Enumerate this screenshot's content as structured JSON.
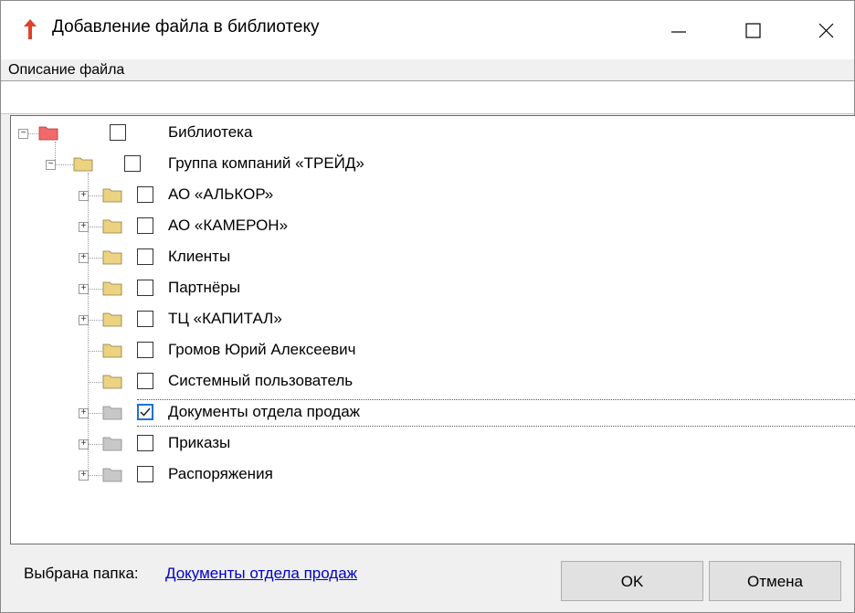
{
  "window": {
    "title": "Добавление файла в библиотеку",
    "app_icon": "red-arrow-up-icon"
  },
  "description": {
    "label": "Описание файла",
    "value": ""
  },
  "tree": {
    "nodes": [
      {
        "label": "Библиотека",
        "level": 0,
        "expanded": true,
        "has_children": true,
        "folder_color": "#f06a6a",
        "checked": false,
        "selected": false
      },
      {
        "label": "Группа компаний «ТРЕЙД»",
        "level": 1,
        "expanded": true,
        "has_children": true,
        "folder_color": "#ecd382",
        "checked": false,
        "selected": false
      },
      {
        "label": "АО «АЛЬКОР»",
        "level": 2,
        "expanded": false,
        "has_children": true,
        "folder_color": "#ecd382",
        "checked": false,
        "selected": false
      },
      {
        "label": "АО «КАМЕРОН»",
        "level": 2,
        "expanded": false,
        "has_children": true,
        "folder_color": "#ecd382",
        "checked": false,
        "selected": false
      },
      {
        "label": "Клиенты",
        "level": 2,
        "expanded": false,
        "has_children": true,
        "folder_color": "#ecd382",
        "checked": false,
        "selected": false
      },
      {
        "label": "Партнёры",
        "level": 2,
        "expanded": false,
        "has_children": true,
        "folder_color": "#ecd382",
        "checked": false,
        "selected": false
      },
      {
        "label": "ТЦ «КАПИТАЛ»",
        "level": 2,
        "expanded": false,
        "has_children": true,
        "folder_color": "#ecd382",
        "checked": false,
        "selected": false
      },
      {
        "label": "Громов Юрий Алексеевич",
        "level": 2,
        "expanded": false,
        "has_children": false,
        "folder_color": "#ecd382",
        "checked": false,
        "selected": false
      },
      {
        "label": "Системный пользователь",
        "level": 2,
        "expanded": false,
        "has_children": false,
        "folder_color": "#ecd382",
        "checked": false,
        "selected": false
      },
      {
        "label": "Документы отдела продаж",
        "level": 2,
        "expanded": false,
        "has_children": true,
        "folder_color": "#c8c8c8",
        "checked": true,
        "selected": true
      },
      {
        "label": "Приказы",
        "level": 2,
        "expanded": false,
        "has_children": true,
        "folder_color": "#c8c8c8",
        "checked": false,
        "selected": false
      },
      {
        "label": "Распоряжения",
        "level": 2,
        "expanded": false,
        "has_children": true,
        "folder_color": "#c8c8c8",
        "checked": false,
        "selected": false
      }
    ]
  },
  "status": {
    "label": "Выбрана папка:",
    "selected_folder": "Документы отдела продаж"
  },
  "buttons": {
    "ok": "OK",
    "cancel": "Отмена"
  }
}
